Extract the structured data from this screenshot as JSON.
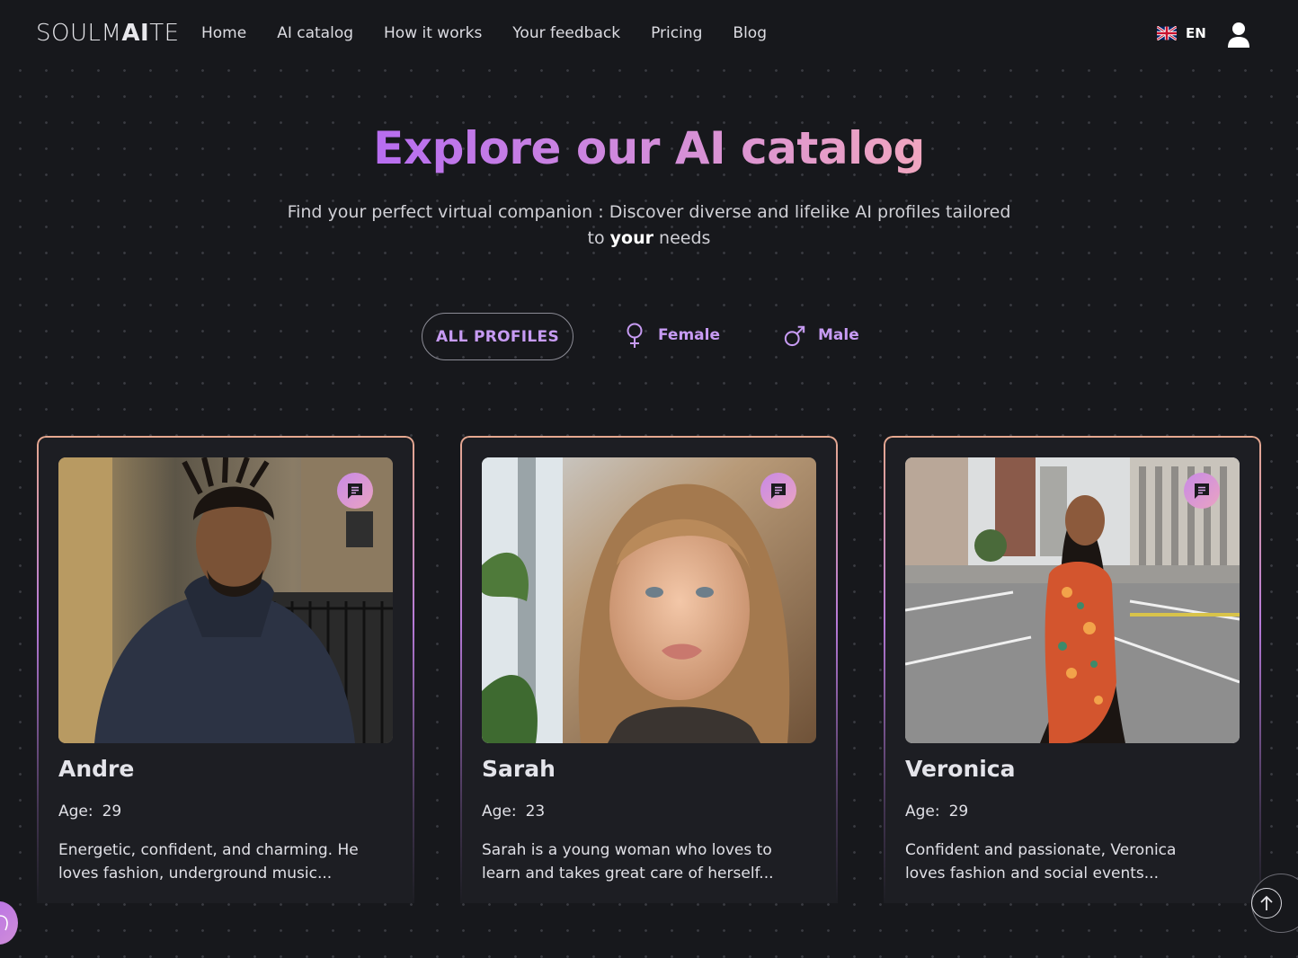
{
  "nav": {
    "logo_thin": "SOULM",
    "logo_bold": "AI",
    "logo_end": "TE",
    "links": [
      "Home",
      "AI catalog",
      "How it works",
      "Your feedback",
      "Pricing",
      "Blog"
    ],
    "language": "EN"
  },
  "hero": {
    "title": "Explore our AI catalog",
    "subtitle_line1": "Find your perfect virtual companion : Discover diverse and lifelike AI profiles tailored",
    "subtitle_pre": "to ",
    "subtitle_bold": "your",
    "subtitle_post": " needs"
  },
  "filters": {
    "all": "ALL PROFILES",
    "female": "Female",
    "male": "Male"
  },
  "profiles": [
    {
      "name": "Andre",
      "age_label": "Age:",
      "age": "29",
      "description": "Energetic, confident, and charming. He loves fashion, underground music..."
    },
    {
      "name": "Sarah",
      "age_label": "Age:",
      "age": "23",
      "description": "Sarah is a young woman who loves to learn and takes great care of herself..."
    },
    {
      "name": "Veronica",
      "age_label": "Age:",
      "age": "29",
      "description": "Confident and passionate, Veronica loves fashion and social events..."
    }
  ],
  "icons": {
    "user": "user-icon",
    "chat": "chat-icon",
    "female": "female-icon",
    "male": "male-icon",
    "scroll_top": "arrow-up-icon",
    "flag": "uk-flag-icon"
  },
  "colors": {
    "background": "#17181c",
    "accent_purple": "#c79bf3",
    "title_gradient_start": "#b76df0",
    "title_gradient_end": "#f0a6bf"
  }
}
